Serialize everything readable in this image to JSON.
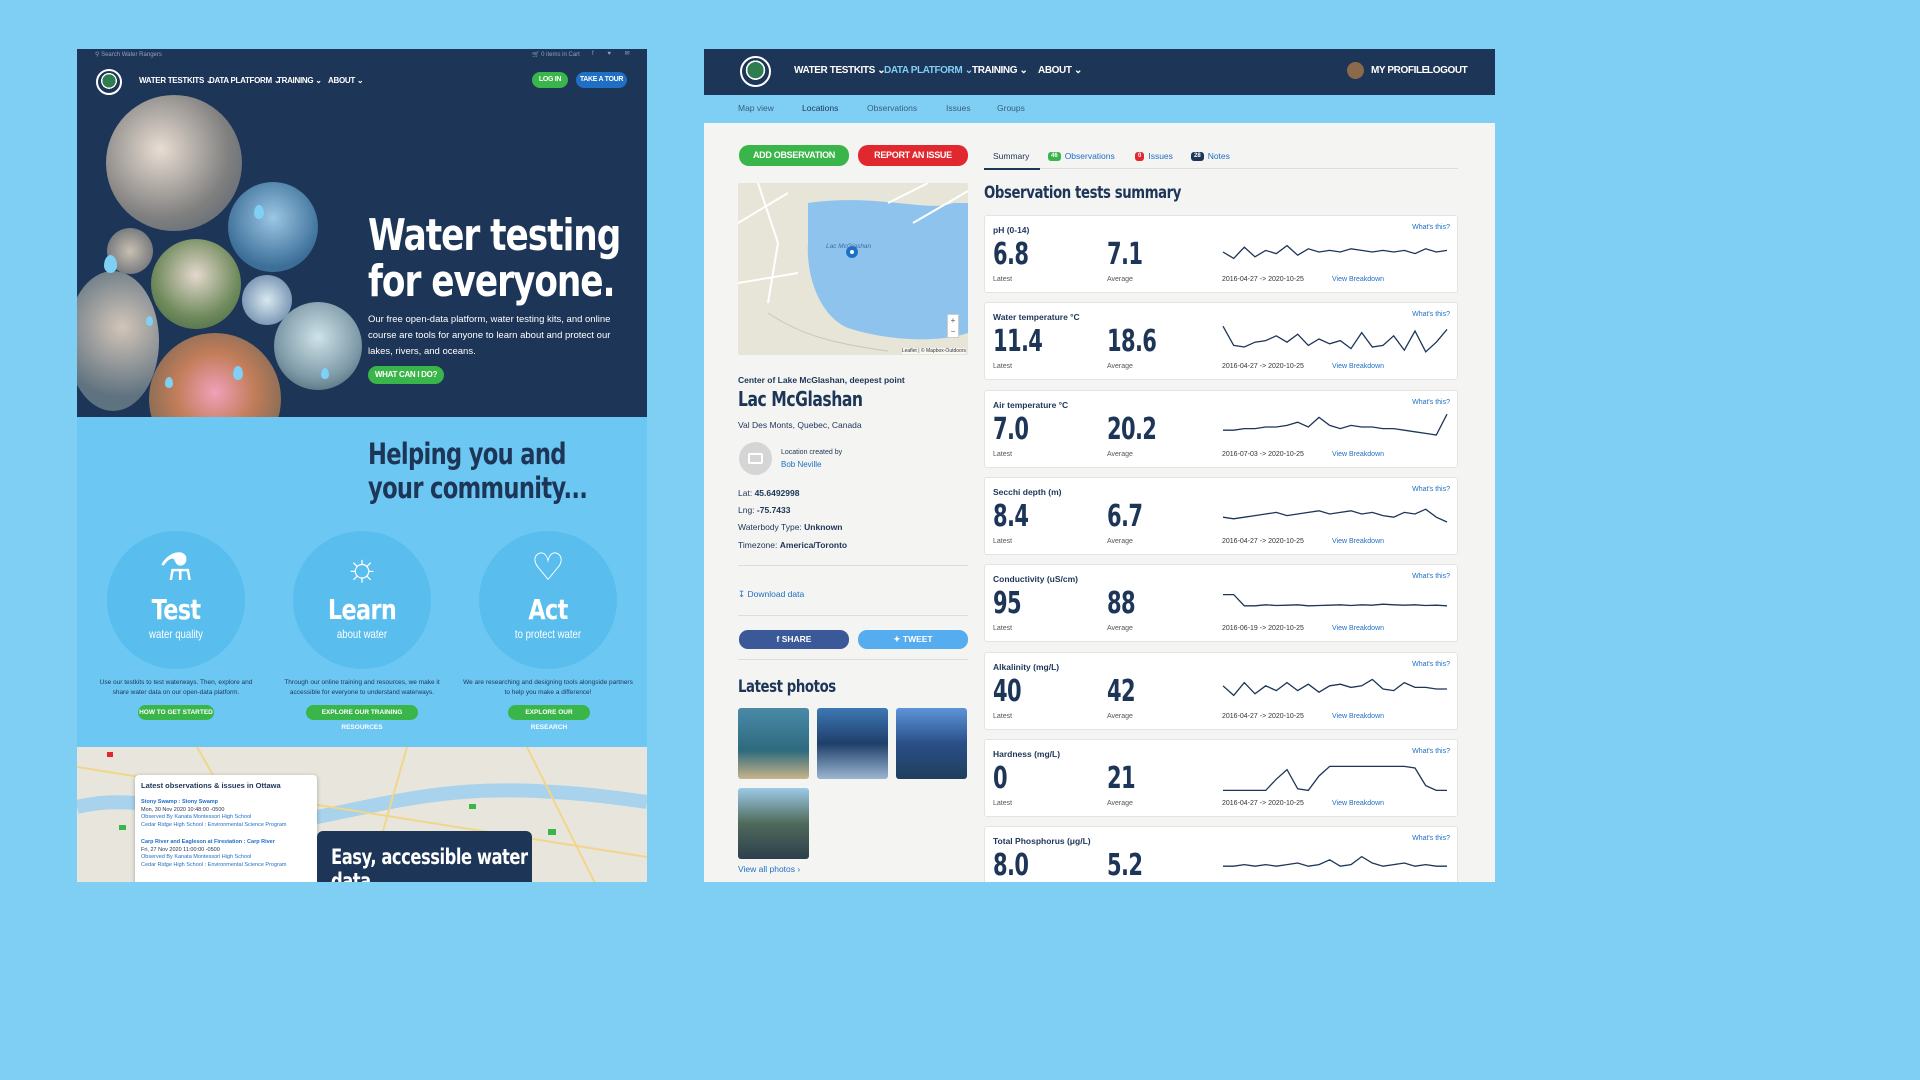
{
  "left": {
    "topbar": {
      "search_placeholder": "Search Water Rangers",
      "cart": "0 items in Cart",
      "social": "f ♥ ✉"
    },
    "nav": {
      "items": [
        "WATER TESTKITS",
        "DATA PLATFORM",
        "TRAINING",
        "ABOUT"
      ],
      "login": "LOG IN",
      "tour": "TAKE A TOUR"
    },
    "hero": {
      "title": "Water testing for everyone.",
      "paragraph": "Our free open-data platform, water testing kits, and online course are tools for anyone to learn about and protect our lakes, rivers, and oceans.",
      "cta": "WHAT CAN I DO?"
    },
    "helping": {
      "title": "Helping you and your community..."
    },
    "pillars": [
      {
        "big": "Test",
        "small": "water quality",
        "blurb": "Use our testkits to test waterways. Then, explore and share water data on our open-data platform.",
        "button": "HOW TO GET STARTED"
      },
      {
        "big": "Learn",
        "small": "about water",
        "blurb": "Through our online training and resources, we make it accessible for everyone to understand waterways.",
        "button": "EXPLORE OUR TRAINING RESOURCES"
      },
      {
        "big": "Act",
        "small": "to protect water",
        "blurb": "We are researching and designing tools alongside partners to help you make a difference!",
        "button": "EXPLORE OUR RESEARCH"
      }
    ],
    "map_card": {
      "title": "Latest observations & issues in Ottawa",
      "items": [
        {
          "name": "Stony Swamp : Stony Swamp",
          "date": "Mon, 30 Nov 2020 10:48:00 -0500",
          "observed": "Observed By Kanata Montessori High School",
          "group": "Cedar Ridge High School : Environmental Science Program"
        },
        {
          "name": "Carp River and Eagleson at Firestation : Carp River",
          "date": "Fri, 27 Nov 2020 11:00:00 -0500",
          "observed": "Observed By Kanata Montessori High School",
          "group": "Cedar Ridge High School : Environmental Science Program"
        }
      ]
    },
    "easy": "Easy, accessible water data"
  },
  "right": {
    "nav": {
      "items": [
        "WATER TESTKITS",
        "DATA PLATFORM",
        "TRAINING",
        "ABOUT"
      ],
      "profile": "MY PROFILE",
      "logout": "LOGOUT"
    },
    "subnav": [
      "Map view",
      "Locations",
      "Observations",
      "Issues",
      "Groups"
    ],
    "buttons": {
      "add": "ADD OBSERVATION",
      "report": "REPORT AN ISSUE"
    },
    "map": {
      "label": "Lac McGlashan",
      "attribution": "Leaflet | © Mapbox-Outdoors"
    },
    "location": {
      "subtitle": "Center of Lake McGlashan, deepest point",
      "name": "Lac McGlashan",
      "region": "Val Des Monts, Quebec, Canada",
      "created_by_label": "Location created by",
      "created_by": "Bob Neville",
      "lat_label": "Lat:",
      "lat": "45.6492998",
      "lng_label": "Lng:",
      "lng": "-75.7433",
      "waterbody_label": "Waterbody Type:",
      "waterbody": "Unknown",
      "timezone_label": "Timezone:",
      "timezone": "America/Toronto",
      "download": "Download data"
    },
    "share": {
      "share": "SHARE",
      "tweet": "TWEET"
    },
    "photos": {
      "title": "Latest photos",
      "view_all": "View all photos ›"
    },
    "tabs": [
      {
        "label": "Summary",
        "badge": ""
      },
      {
        "label": "Observations",
        "badge": "46"
      },
      {
        "label": "Issues",
        "badge": "0"
      },
      {
        "label": "Notes",
        "badge": "28"
      }
    ],
    "summary_title": "Observation tests summary",
    "cards": [
      {
        "name": "pH (0-14)",
        "latest": "6.8",
        "average": "7.1",
        "range": "2016-04-27 -> 2020-10-25",
        "spark": [
          0.5,
          0.7,
          0.35,
          0.65,
          0.45,
          0.55,
          0.3,
          0.6,
          0.4,
          0.5,
          0.45,
          0.5,
          0.4,
          0.45,
          0.5,
          0.45,
          0.5,
          0.45,
          0.55,
          0.4,
          0.5,
          0.45
        ]
      },
      {
        "name": "Water temperature °C",
        "latest": "11.4",
        "average": "18.6",
        "range": "2016-04-27 -> 2020-10-25",
        "spark": [
          0.1,
          0.7,
          0.75,
          0.6,
          0.55,
          0.4,
          0.6,
          0.35,
          0.7,
          0.5,
          0.65,
          0.55,
          0.8,
          0.3,
          0.75,
          0.7,
          0.4,
          0.85,
          0.25,
          0.9,
          0.6,
          0.2
        ]
      },
      {
        "name": "Air temperature °C",
        "latest": "7.0",
        "average": "20.2",
        "range": "2016-07-03 -> 2020-10-25",
        "spark": [
          0.6,
          0.6,
          0.55,
          0.55,
          0.5,
          0.5,
          0.45,
          0.35,
          0.5,
          0.2,
          0.45,
          0.55,
          0.45,
          0.5,
          0.5,
          0.55,
          0.55,
          0.6,
          0.65,
          0.7,
          0.75,
          0.1
        ]
      },
      {
        "name": "Secchi depth (m)",
        "latest": "8.4",
        "average": "6.7",
        "range": "2016-04-27 -> 2020-10-25",
        "spark": [
          0.6,
          0.65,
          0.6,
          0.55,
          0.5,
          0.45,
          0.55,
          0.5,
          0.45,
          0.4,
          0.5,
          0.45,
          0.4,
          0.5,
          0.45,
          0.55,
          0.6,
          0.45,
          0.5,
          0.35,
          0.6,
          0.75
        ]
      },
      {
        "name": "Conductivity (uS/cm)",
        "latest": "95",
        "average": "88",
        "range": "2016-06-19 -> 2020-10-25",
        "spark": [
          0.3,
          0.3,
          0.65,
          0.65,
          0.62,
          0.64,
          0.63,
          0.62,
          0.65,
          0.64,
          0.63,
          0.62,
          0.64,
          0.62,
          0.63,
          0.6,
          0.62,
          0.63,
          0.62,
          0.64,
          0.63,
          0.65
        ]
      },
      {
        "name": "Alkalinity (mg/L)",
        "latest": "40",
        "average": "42",
        "range": "2016-04-27 -> 2020-10-25",
        "spark": [
          0.4,
          0.7,
          0.3,
          0.65,
          0.4,
          0.55,
          0.3,
          0.55,
          0.35,
          0.6,
          0.4,
          0.35,
          0.45,
          0.4,
          0.2,
          0.5,
          0.55,
          0.3,
          0.45,
          0.45,
          0.5,
          0.5
        ]
      },
      {
        "name": "Hardness (mg/L)",
        "latest": "0",
        "average": "21",
        "range": "2016-04-27 -> 2020-10-25",
        "spark": [
          0.95,
          0.95,
          0.95,
          0.95,
          0.95,
          0.6,
          0.3,
          0.9,
          0.95,
          0.5,
          0.2,
          0.2,
          0.2,
          0.2,
          0.2,
          0.2,
          0.2,
          0.2,
          0.25,
          0.8,
          0.95,
          0.95
        ]
      },
      {
        "name": "Total Phosphorus (μg/L)",
        "latest": "8.0",
        "average": "5.2",
        "range": "",
        "spark": [
          0.6,
          0.6,
          0.55,
          0.6,
          0.55,
          0.6,
          0.55,
          0.5,
          0.6,
          0.55,
          0.4,
          0.6,
          0.55,
          0.3,
          0.5,
          0.6,
          0.55,
          0.5,
          0.6,
          0.55,
          0.6,
          0.6
        ]
      }
    ],
    "whats_this": "What's this?",
    "latest_label": "Latest",
    "average_label": "Average",
    "view_breakdown": "View Breakdown"
  }
}
